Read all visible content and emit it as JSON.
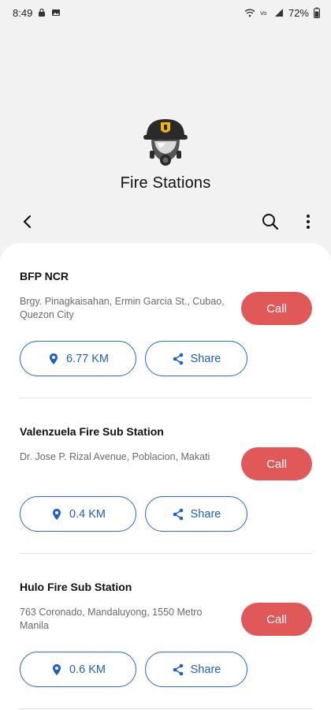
{
  "status_bar": {
    "time": "8:49",
    "battery": "72%"
  },
  "header": {
    "title": "Fire Stations",
    "logo_icon": "firefighter-helmet-mask-icon"
  },
  "toolbar": {
    "back_icon": "back-arrow-icon",
    "search_icon": "search-icon",
    "more_icon": "more-vert-icon"
  },
  "colors": {
    "call_button": "#e05858",
    "accent_blue": "#2b6fd6",
    "background": "#f2f2f2"
  },
  "stations": [
    {
      "name": "BFP NCR",
      "address": "Brgy. Pinagkaisahan, Ermin Garcia St., Cubao, Quezon City",
      "call_label": "Call",
      "distance": "6.77 KM",
      "share_label": "Share"
    },
    {
      "name": "Valenzuela Fire Sub Station",
      "address": "Dr. Jose P. Rizal Avenue, Poblacion, Makati",
      "call_label": "Call",
      "distance": "0.4 KM",
      "share_label": "Share"
    },
    {
      "name": "Hulo Fire Sub Station",
      "address": "763 Coronado, Mandaluyong, 1550 Metro Manila",
      "call_label": "Call",
      "distance": "0.6 KM",
      "share_label": "Share"
    }
  ]
}
